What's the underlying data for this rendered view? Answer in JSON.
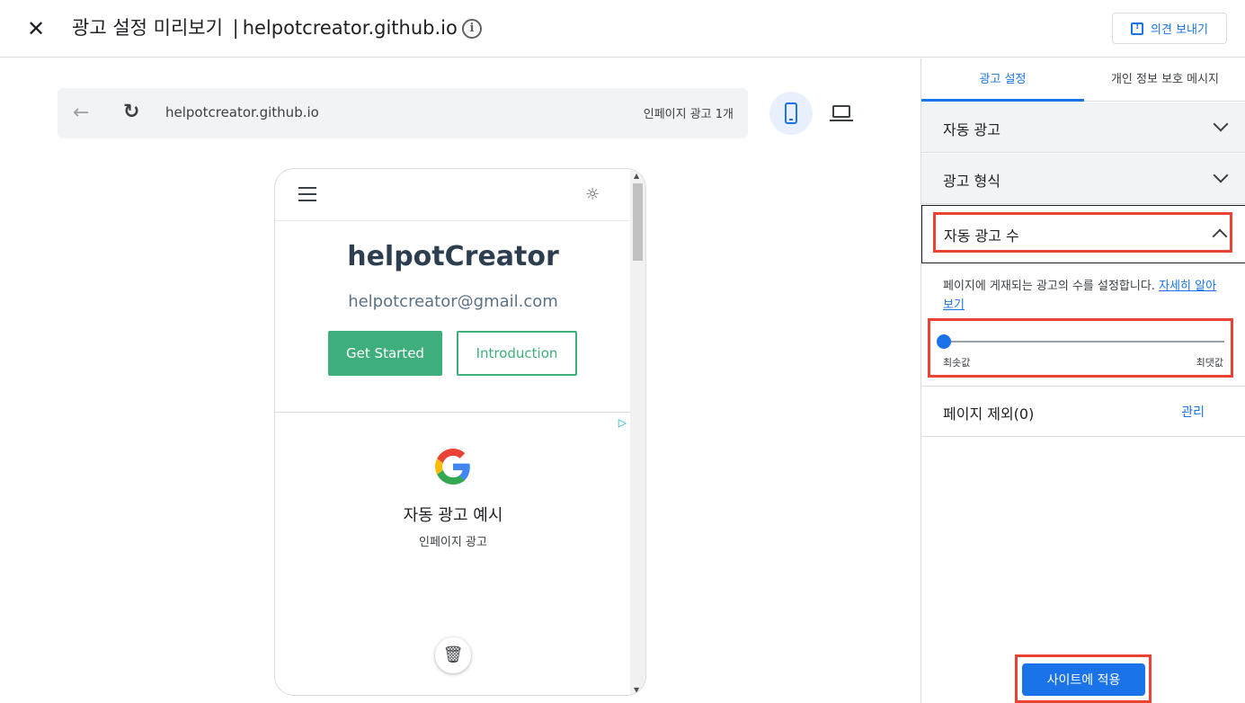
{
  "header": {
    "close_glyph": "✕",
    "title": "광고 설정 미리보기",
    "separator": "|",
    "domain": "helpotcreator.github.io",
    "info_glyph": "i",
    "feedback_label": "의견 보내기"
  },
  "browser": {
    "back_glyph": "←",
    "reload_glyph": "↻",
    "url": "helpotcreator.github.io",
    "ad_count": "인페이지 광고 1개"
  },
  "preview": {
    "site_name": "helpotCreator",
    "email": "helpotcreator@gmail.com",
    "get_started": "Get Started",
    "introduction": "Introduction",
    "sun_glyph": "☼",
    "ad": {
      "choice_glyph": "▷",
      "title": "자동 광고 예시",
      "subtitle": "인페이지 광고",
      "trash_glyph": "🗑"
    },
    "scroll_up": "▲",
    "scroll_down": "▼"
  },
  "panel": {
    "tabs": [
      "광고 설정",
      "개인 정보 보호 메시지"
    ],
    "sections": {
      "auto_ads": "자동 광고",
      "ad_formats": "광고 형식",
      "ad_load": "자동 광고 수"
    },
    "description": "페이지에 게재되는 광고의 수를 설정합니다.",
    "learn_more": "자세히 알아보기",
    "slider": {
      "value": 0,
      "min_label": "최솟값",
      "max_label": "최댓값"
    },
    "page_exclusions": "페이지 제외(0)",
    "manage": "관리",
    "apply": "사이트에 적용"
  },
  "colors": {
    "accent": "#1a73e8",
    "brand_green": "#3eaf7c",
    "highlight": "#ea4335"
  },
  "icons": [
    "close-icon",
    "info-icon",
    "feedback-icon",
    "back-arrow-icon",
    "reload-icon",
    "mobile-icon",
    "laptop-icon",
    "menu-icon",
    "sun-icon",
    "adchoices-icon",
    "google-logo",
    "trash-icon",
    "chevron-down-icon",
    "chevron-up-icon"
  ]
}
